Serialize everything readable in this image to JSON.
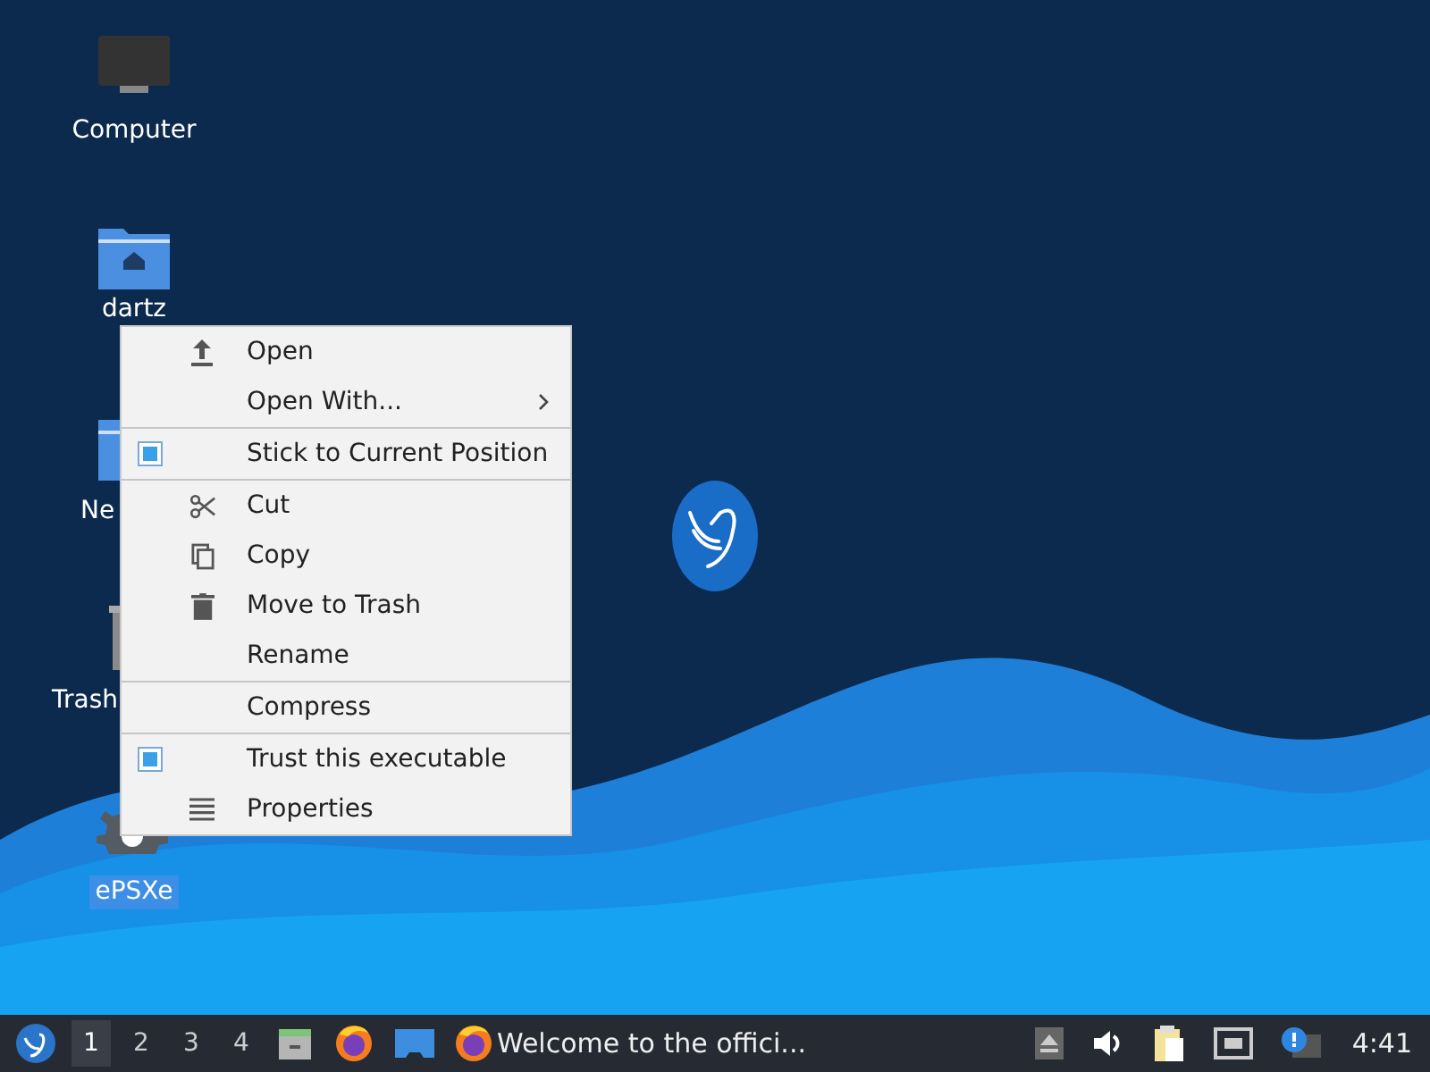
{
  "desktop_icons": [
    {
      "kind": "computer",
      "label": "Computer",
      "selected": false
    },
    {
      "kind": "home-folder",
      "label": "dartz",
      "selected": false
    },
    {
      "kind": "folder",
      "label": "Ne",
      "selected": false
    },
    {
      "kind": "trash",
      "label": "Trash",
      "selected": false
    },
    {
      "kind": "gear",
      "label": "ePSXe",
      "selected": true
    }
  ],
  "context_menu": {
    "sections": [
      [
        {
          "kind": "upload",
          "label": "Open"
        },
        {
          "kind": "submenu",
          "label": "Open With..."
        }
      ],
      [
        {
          "kind": "check",
          "label": "Stick to Current Position",
          "checked": true
        }
      ],
      [
        {
          "kind": "scissors",
          "label": "Cut"
        },
        {
          "kind": "copy",
          "label": "Copy"
        },
        {
          "kind": "trash",
          "label": "Move to Trash"
        },
        {
          "kind": "plain",
          "label": "Rename"
        }
      ],
      [
        {
          "kind": "plain",
          "label": "Compress"
        }
      ],
      [
        {
          "kind": "check",
          "label": "Trust this executable",
          "checked": true
        },
        {
          "kind": "list",
          "label": "Properties"
        }
      ]
    ]
  },
  "taskbar": {
    "workspaces": [
      {
        "label": "1",
        "selected": true
      },
      {
        "label": "2",
        "selected": false
      },
      {
        "label": "3",
        "selected": false
      },
      {
        "label": "4",
        "selected": false
      }
    ],
    "launchers": [
      {
        "kind": "files"
      },
      {
        "kind": "browser"
      },
      {
        "kind": "desktop"
      }
    ],
    "task": {
      "label": "Welcome to the offici..."
    },
    "tray": [
      {
        "kind": "eject"
      },
      {
        "kind": "volume"
      },
      {
        "kind": "clipboard"
      },
      {
        "kind": "network"
      },
      {
        "kind": "notification"
      }
    ],
    "clock": "4:41"
  }
}
